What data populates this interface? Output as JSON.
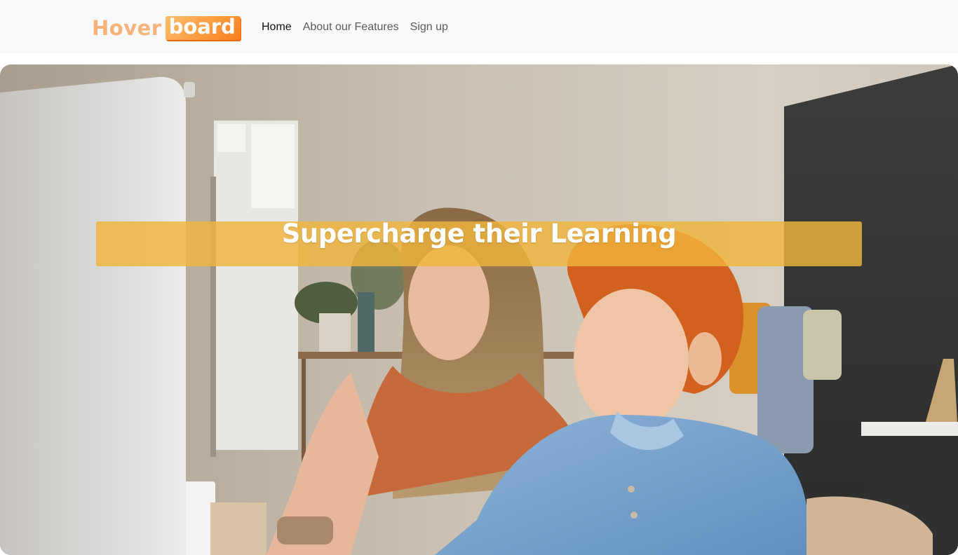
{
  "brand": {
    "logo_word_1": "Hover",
    "logo_word_2": "board",
    "logo_color_1": "#f6b47a",
    "logo_color_2": "#f97e1e"
  },
  "nav": {
    "items": [
      {
        "label": "Home",
        "active": true
      },
      {
        "label": "About our Features",
        "active": false
      },
      {
        "label": "Sign up",
        "active": false
      }
    ]
  },
  "hero": {
    "title": "Supercharge their Learning",
    "banner_color": "#f0b43c",
    "image_description_icon": "photo-mother-and-son-at-computer"
  }
}
